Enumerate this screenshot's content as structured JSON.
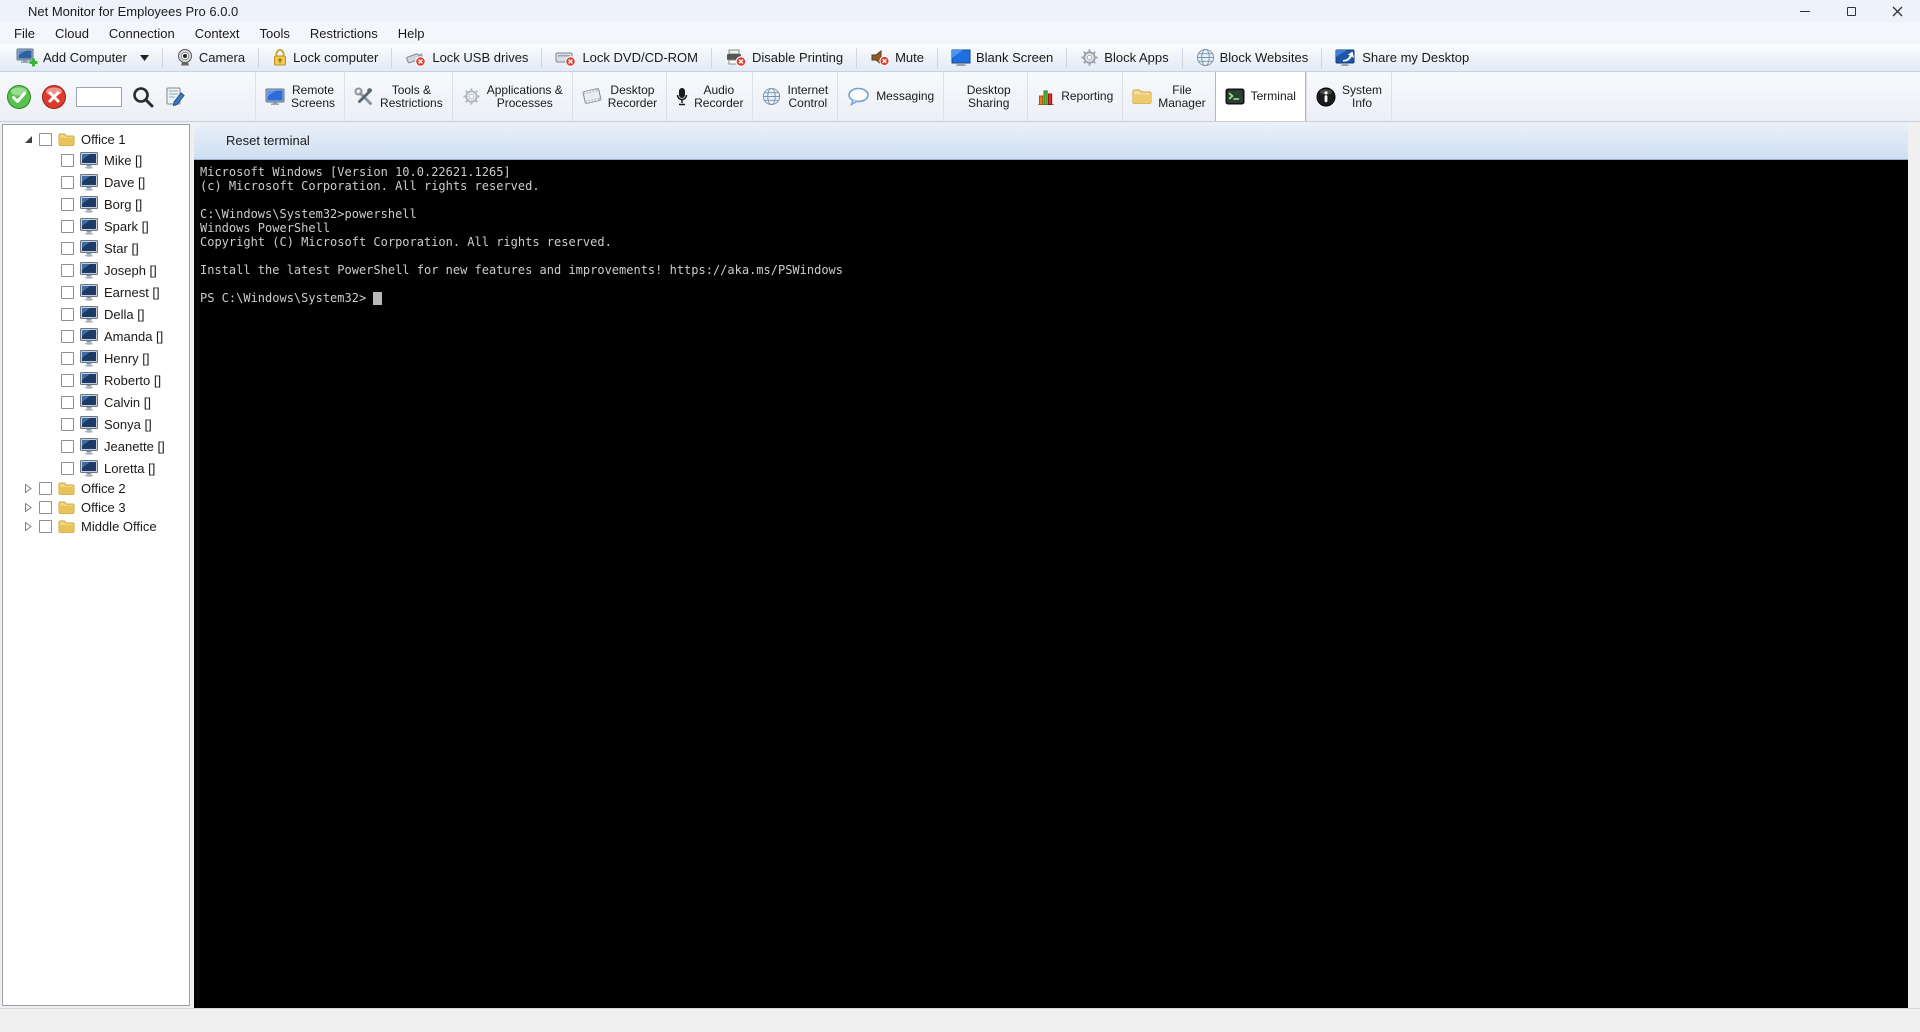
{
  "window": {
    "title": "Net Monitor for Employees Pro 6.0.0",
    "controls": [
      {
        "name": "minimize"
      },
      {
        "name": "maximize"
      },
      {
        "name": "close"
      }
    ]
  },
  "menu": {
    "items": [
      "File",
      "Cloud",
      "Connection",
      "Context",
      "Tools",
      "Restrictions",
      "Help"
    ]
  },
  "toolbar": {
    "items": [
      {
        "label": "Add Computer",
        "icon": "add-computer-icon",
        "dropdown": true
      },
      {
        "label": "Camera",
        "icon": "camera-icon"
      },
      {
        "label": "Lock computer",
        "icon": "lock-computer-icon"
      },
      {
        "label": "Lock USB drives",
        "icon": "lock-usb-icon"
      },
      {
        "label": "Lock DVD/CD-ROM",
        "icon": "lock-dvd-icon"
      },
      {
        "label": "Disable Printing",
        "icon": "disable-printing-icon"
      },
      {
        "label": "Mute",
        "icon": "mute-icon"
      },
      {
        "label": "Blank Screen",
        "icon": "blank-screen-icon"
      },
      {
        "label": "Block Apps",
        "icon": "block-apps-icon"
      },
      {
        "label": "Block Websites",
        "icon": "block-websites-icon"
      },
      {
        "label": "Share my Desktop",
        "icon": "share-desktop-icon"
      }
    ]
  },
  "actionbar": {
    "search_value": "",
    "buttons": [
      {
        "name": "connect",
        "icon": "connect-icon"
      },
      {
        "name": "disconnect",
        "icon": "disconnect-icon"
      },
      {
        "name": "search",
        "icon": "search-icon"
      },
      {
        "name": "log",
        "icon": "log-icon"
      }
    ]
  },
  "tabs": [
    {
      "id": "remote-screens",
      "lines": [
        "Remote",
        "Screens"
      ],
      "icon": "remote-screens-icon",
      "selected": false
    },
    {
      "id": "tools-restrictions",
      "lines": [
        "Tools &",
        "Restrictions"
      ],
      "icon": "tools-restrictions-icon",
      "selected": false
    },
    {
      "id": "applications-processes",
      "lines": [
        "Applications &",
        "Processes"
      ],
      "icon": "applications-processes-icon",
      "selected": false
    },
    {
      "id": "desktop-recorder",
      "lines": [
        "Desktop",
        "Recorder"
      ],
      "icon": "desktop-recorder-icon",
      "selected": false
    },
    {
      "id": "audio-recorder",
      "lines": [
        "Audio",
        "Recorder"
      ],
      "icon": "audio-recorder-icon",
      "selected": false
    },
    {
      "id": "internet-control",
      "lines": [
        "Internet",
        "Control"
      ],
      "icon": "internet-control-icon",
      "selected": false
    },
    {
      "id": "messaging",
      "lines": [
        "Messaging"
      ],
      "icon": "messaging-icon",
      "selected": false
    },
    {
      "id": "desktop-sharing",
      "lines": [
        "Desktop",
        "Sharing"
      ],
      "icon": "desktop-sharing-icon",
      "selected": false
    },
    {
      "id": "reporting",
      "lines": [
        "Reporting"
      ],
      "icon": "reporting-icon",
      "selected": false
    },
    {
      "id": "file-manager",
      "lines": [
        "File",
        "Manager"
      ],
      "icon": "file-manager-icon",
      "selected": false
    },
    {
      "id": "terminal",
      "lines": [
        "Terminal"
      ],
      "icon": "terminal-icon",
      "selected": true
    },
    {
      "id": "system-info",
      "lines": [
        "System",
        "Info"
      ],
      "icon": "system-info-icon",
      "selected": false
    }
  ],
  "sidebar": {
    "groups": [
      {
        "label": "Office 1",
        "expanded": true,
        "items": [
          "Mike []",
          "Dave []",
          "Borg []",
          "Spark []",
          "Star []",
          "Joseph []",
          "Earnest []",
          "Della []",
          "Amanda []",
          "Henry []",
          "Roberto []",
          "Calvin []",
          "Sonya []",
          "Jeanette []",
          "Loretta []"
        ]
      },
      {
        "label": "Office 2",
        "expanded": false,
        "items": []
      },
      {
        "label": "Office 3",
        "expanded": false,
        "items": []
      },
      {
        "label": "Middle Office",
        "expanded": false,
        "items": []
      }
    ]
  },
  "terminal": {
    "reset_label": "Reset terminal",
    "lines": [
      "Microsoft Windows [Version 10.0.22621.1265]",
      "(c) Microsoft Corporation. All rights reserved.",
      "",
      "C:\\Windows\\System32>powershell",
      "Windows PowerShell",
      "Copyright (C) Microsoft Corporation. All rights reserved.",
      "",
      "Install the latest PowerShell for new features and improvements! https://aka.ms/PSWindows",
      "",
      "PS C:\\Windows\\System32> "
    ],
    "cursor": true
  },
  "colors": {
    "terminal_bg": "#000000",
    "terminal_text": "#cccccc",
    "selected_tab_bg": "#ffffff",
    "toolbar_tint": "#e2eaf5",
    "reset_bar_tint": "#cfdff1"
  },
  "icons": {
    "app-icon": "webcam-with-red-pointer",
    "add-computer-icon": "monitor-with-green-plus",
    "camera-icon": "webcam-lens",
    "lock-computer-icon": "yellow-padlock",
    "lock-usb-icon": "usb-stick-with-red-block",
    "lock-dvd-icon": "disc-drive-with-red-block",
    "disable-printing-icon": "printer-with-red-block",
    "mute-icon": "speaker-with-red-block",
    "blank-screen-icon": "blue-monitor",
    "block-apps-icon": "gray-gear",
    "block-websites-icon": "globe",
    "share-desktop-icon": "monitor-with-share-arrow",
    "connect-icon": "green-sphere-check",
    "disconnect-icon": "red-sphere-x",
    "search-icon": "magnifier",
    "log-icon": "page-with-pencil",
    "remote-screens-icon": "blue-monitor",
    "tools-restrictions-icon": "crossed-tools",
    "applications-processes-icon": "gray-gear",
    "desktop-recorder-icon": "film-strip",
    "audio-recorder-icon": "black-microphone",
    "internet-control-icon": "globe",
    "messaging-icon": "speech-bubble",
    "reporting-icon": "bar-chart",
    "file-manager-icon": "yellow-folder",
    "terminal-icon": "console-prompt",
    "system-info-icon": "black-info-circle",
    "minimize-icon": "horizontal-line",
    "maximize-icon": "square-outline",
    "close-icon": "x-cross",
    "expanded-twisty-icon": "filled-triangle",
    "collapsed-twisty-icon": "outline-triangle",
    "dropdown-arrow-icon": "down-triangle",
    "folder-icon": "yellow-folder",
    "computer-icon": "blue-monitor"
  }
}
